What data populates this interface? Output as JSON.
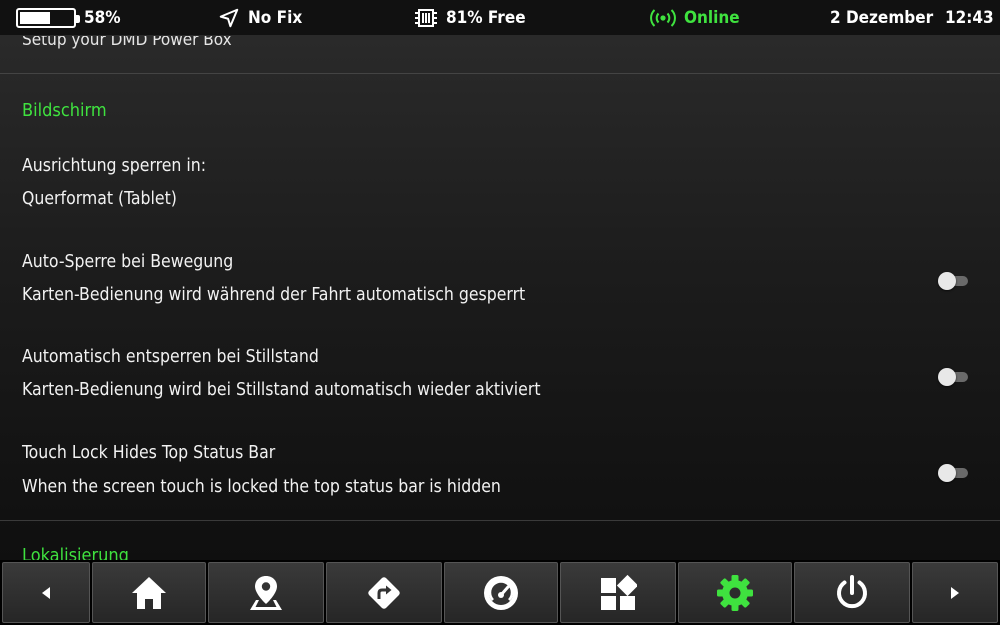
{
  "status_bar": {
    "battery_percent": 58,
    "battery_text": "58%",
    "gps_text": "No Fix",
    "memory_text": "81% Free",
    "network_text": "Online",
    "date_text": "2 Dezember",
    "time_text": "12:43"
  },
  "settings": {
    "previous_item_text": "Setup your DMD Power Box",
    "section_title": "Bildschirm",
    "orientation": {
      "title": "Ausrichtung sperren in:",
      "value": "Querformat (Tablet)"
    },
    "auto_lock": {
      "title": "Auto-Sperre bei Bewegung",
      "subtitle": "Karten-Bedienung wird während der Fahrt automatisch gesperrt",
      "enabled": false
    },
    "auto_unlock": {
      "title": "Automatisch entsperren bei Stillstand",
      "subtitle": "Karten-Bedienung wird bei Stillstand automatisch wieder aktiviert",
      "enabled": false
    },
    "touch_lock_status": {
      "title": "Touch Lock Hides Top Status Bar",
      "subtitle": "When the screen touch is locked the top status bar is hidden",
      "enabled": false
    },
    "next_section_title": "Lokalisierung"
  },
  "nav": {
    "items": [
      {
        "icon": "arrow-left-icon"
      },
      {
        "icon": "home-icon"
      },
      {
        "icon": "map-pin-icon"
      },
      {
        "icon": "route-icon"
      },
      {
        "icon": "speedometer-icon"
      },
      {
        "icon": "dashboard-icon"
      },
      {
        "icon": "gear-icon",
        "active": true
      },
      {
        "icon": "power-icon"
      },
      {
        "icon": "arrow-right-icon"
      }
    ]
  },
  "colors": {
    "accent": "#3fe23f",
    "background": "#1c1c1c",
    "status_bar": "#111111"
  }
}
